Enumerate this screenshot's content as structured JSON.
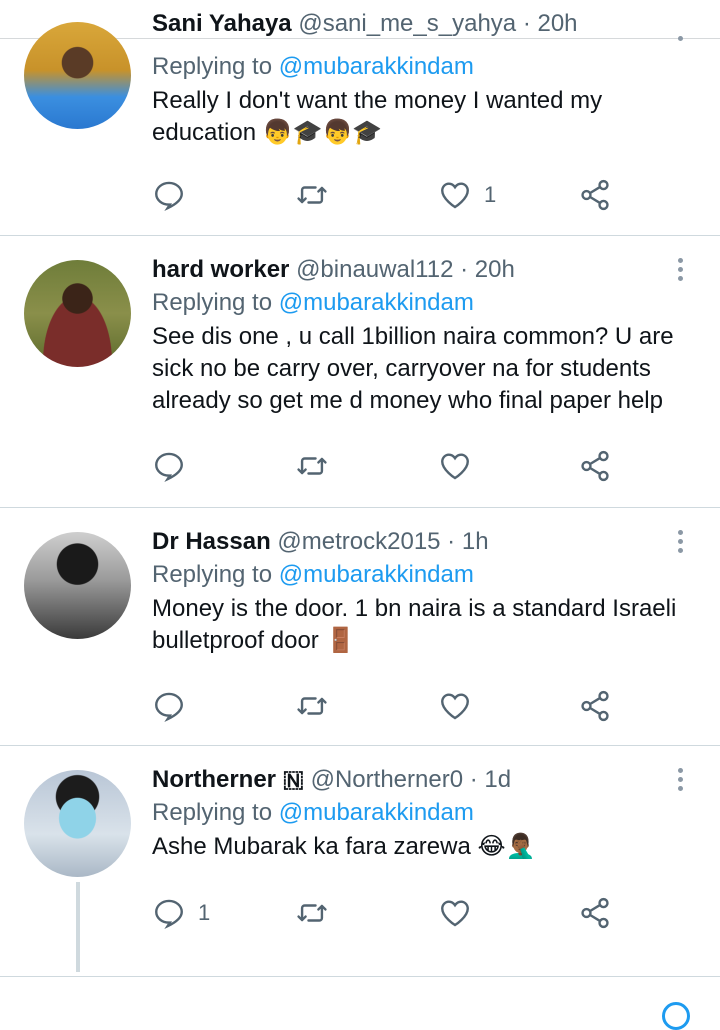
{
  "top_partial": {
    "name": "Sani Yahaya",
    "handle": "@sani_me_s_yahya · 20h"
  },
  "tweets": [
    {
      "name": "",
      "handle": "",
      "time": "",
      "replying_label": "Replying to ",
      "replying_to": "@mubarakkindam",
      "text": "Really I don't want the money I wanted my education 👦🎓👦🎓",
      "like_count": "1",
      "reply_count": ""
    },
    {
      "name": "hard worker",
      "handle": "@binauwal112",
      "time": " · 20h",
      "replying_label": "Replying to ",
      "replying_to": "@mubarakkindam",
      "text": "See dis one , u call 1billion naira common? U are sick no be carry over, carryover na for students already so get me d money who final paper help",
      "like_count": "",
      "reply_count": ""
    },
    {
      "name": "Dr Hassan",
      "handle": "@metrock2015",
      "time": " · 1h",
      "replying_label": "Replying to ",
      "replying_to": "@mubarakkindam",
      "text": "Money is the door. 1 bn naira is a standard Israeli bulletproof door 🚪",
      "like_count": "",
      "reply_count": ""
    },
    {
      "name": "Northerner 🇳",
      "handle": "@Northerner0",
      "time": " · 1d",
      "replying_label": "Replying to ",
      "replying_to": "@mubarakkindam",
      "text": "Ashe Mubarak ka fara zarewa 😂🤦🏾‍♂️",
      "like_count": "",
      "reply_count": "1"
    }
  ],
  "icons": {
    "reply": "reply-icon",
    "retweet": "retweet-icon",
    "like": "heart-icon",
    "share": "share-icon",
    "more": "more-vertical-icon"
  },
  "colors": {
    "accent": "#1d9bf0",
    "muted": "#536471",
    "divider": "#cfd9de"
  }
}
